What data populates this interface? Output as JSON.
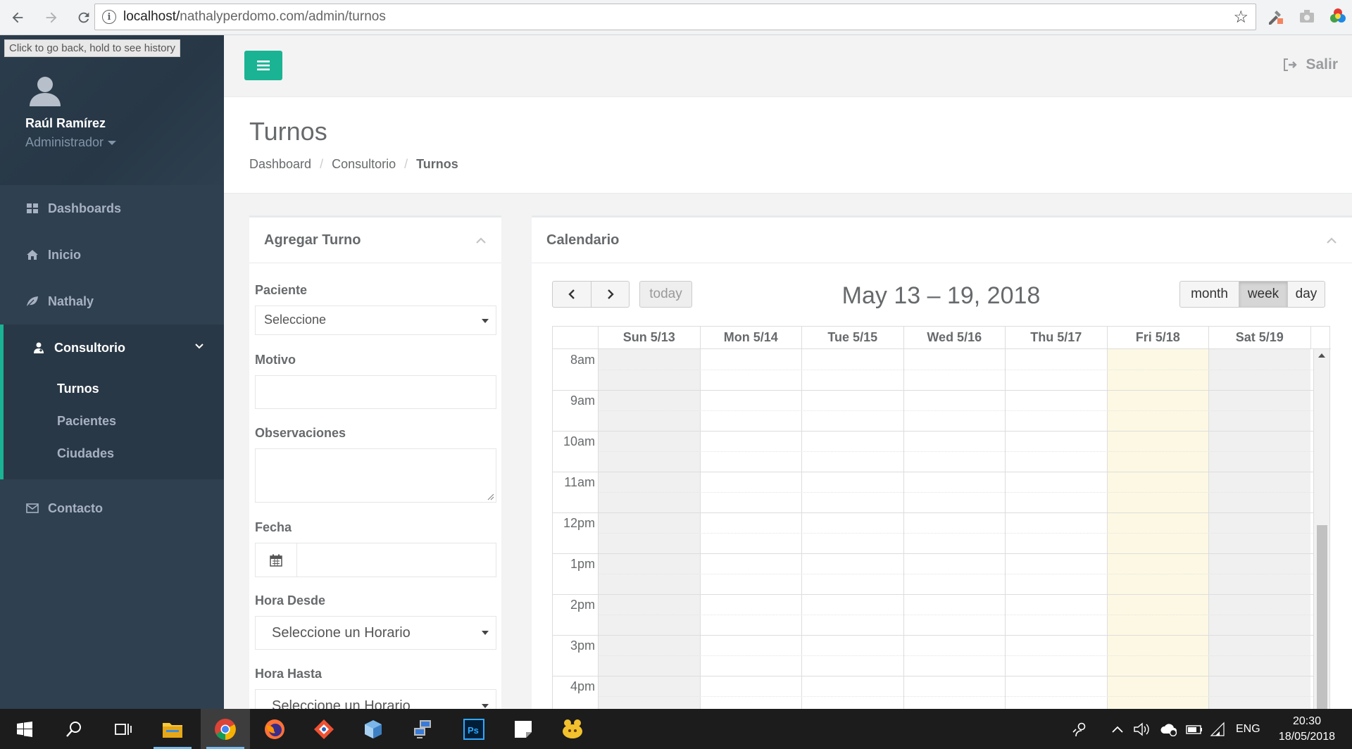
{
  "browser": {
    "url_host": "localhost/",
    "url_path": "nathalyperdomo.com/admin/turnos"
  },
  "tooltip": "Click to go back, hold to see history",
  "profile": {
    "name": "Raúl Ramírez",
    "role": "Administrador"
  },
  "sidebar": {
    "items": [
      {
        "label": "Dashboards",
        "icon": "grid-icon"
      },
      {
        "label": "Inicio",
        "icon": "home-icon"
      },
      {
        "label": "Nathaly",
        "icon": "leaf-icon"
      },
      {
        "label": "Consultorio",
        "icon": "user-md-icon"
      },
      {
        "label": "Contacto",
        "icon": "envelope-icon"
      }
    ],
    "submenu": [
      {
        "label": "Turnos"
      },
      {
        "label": "Pacientes"
      },
      {
        "label": "Ciudades"
      }
    ]
  },
  "topbar": {
    "logout_label": "Salir"
  },
  "heading": {
    "title": "Turnos",
    "breadcrumb": [
      "Dashboard",
      "Consultorio",
      "Turnos"
    ]
  },
  "form_panel": {
    "title": "Agregar Turno",
    "fields": {
      "paciente_label": "Paciente",
      "paciente_value": "Seleccione",
      "motivo_label": "Motivo",
      "observaciones_label": "Observaciones",
      "fecha_label": "Fecha",
      "hora_desde_label": "Hora Desde",
      "hora_desde_value": "Seleccione un Horario",
      "hora_hasta_label": "Hora Hasta",
      "hora_hasta_value": "Seleccione un Horario"
    }
  },
  "calendar_panel": {
    "title": "Calendario",
    "range_title": "May 13 – 19, 2018",
    "today_label": "today",
    "views": [
      "month",
      "week",
      "day"
    ],
    "active_view": "week",
    "days": [
      "Sun 5/13",
      "Mon 5/14",
      "Tue 5/15",
      "Wed 5/16",
      "Thu 5/17",
      "Fri 5/18",
      "Sat 5/19"
    ],
    "today_index": 5,
    "times": [
      "8am",
      "9am",
      "10am",
      "11am",
      "12pm",
      "1pm",
      "2pm",
      "3pm",
      "4pm"
    ],
    "colors": {
      "today": "#fcf8e3",
      "weekend": "#f0f0f0"
    }
  },
  "taskbar": {
    "lang": "ENG",
    "time": "20:30",
    "date": "18/05/2018"
  },
  "colors": {
    "sidebar_bg": "#2f4050",
    "accent": "#1ab394"
  }
}
